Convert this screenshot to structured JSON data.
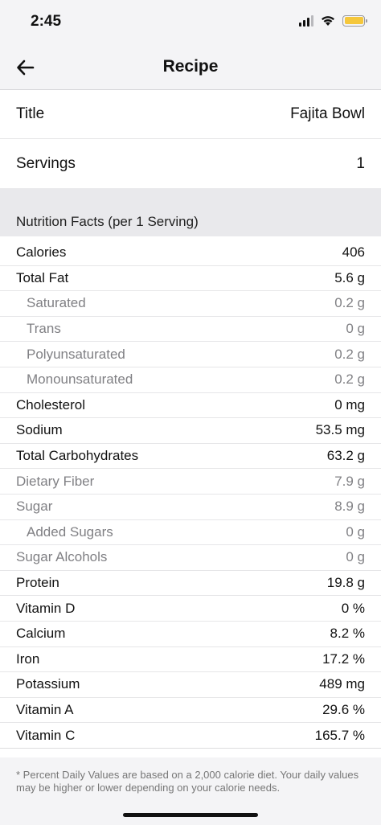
{
  "status_bar": {
    "time": "2:45"
  },
  "nav": {
    "title": "Recipe",
    "back_icon": "arrow-left-icon"
  },
  "fields": {
    "title_label": "Title",
    "title_value": "Fajita Bowl",
    "servings_label": "Servings",
    "servings_value": "1"
  },
  "nutrition": {
    "header": "Nutrition Facts (per 1 Serving)",
    "items": [
      {
        "label": "Calories",
        "value": "406"
      },
      {
        "label": "Total Fat",
        "value": "5.6 g"
      },
      {
        "label": "Saturated",
        "value": "0.2 g"
      },
      {
        "label": "Trans",
        "value": "0 g"
      },
      {
        "label": "Polyunsaturated",
        "value": "0.2 g"
      },
      {
        "label": "Monounsaturated",
        "value": "0.2 g"
      },
      {
        "label": "Cholesterol",
        "value": "0 mg"
      },
      {
        "label": "Sodium",
        "value": "53.5 mg"
      },
      {
        "label": "Total Carbohydrates",
        "value": "63.2 g"
      },
      {
        "label": "Dietary Fiber",
        "value": "7.9 g"
      },
      {
        "label": "Sugar",
        "value": "8.9 g"
      },
      {
        "label": "Added Sugars",
        "value": "0 g"
      },
      {
        "label": "Sugar Alcohols",
        "value": "0 g"
      },
      {
        "label": "Protein",
        "value": "19.8 g"
      },
      {
        "label": "Vitamin D",
        "value": "0 %"
      },
      {
        "label": "Calcium",
        "value": "8.2 %"
      },
      {
        "label": "Iron",
        "value": "17.2 %"
      },
      {
        "label": "Potassium",
        "value": "489 mg"
      },
      {
        "label": "Vitamin A",
        "value": "29.6 %"
      },
      {
        "label": "Vitamin C",
        "value": "165.7 %"
      }
    ]
  },
  "footer": {
    "note": "* Percent Daily Values are based on a 2,000 calorie diet.  Your daily values may be higher or lower depending on your calorie needs."
  },
  "colors": {
    "battery": "#f5c73b",
    "secondary_text": "#808084"
  }
}
